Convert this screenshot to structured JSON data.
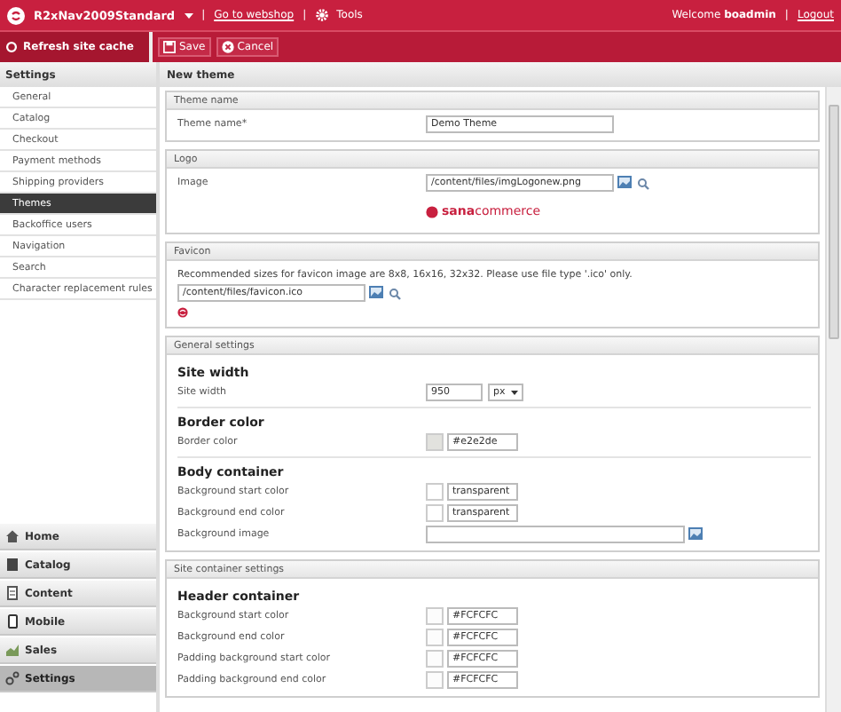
{
  "top_bar": {
    "site": "R2xNav2009Standard",
    "separator_1": "|",
    "webshop_link": "Go to webshop",
    "separator_2": "|",
    "tools": "Tools",
    "welcome": "Welcome **boadmin**",
    "separator_3": "|",
    "logout": "Logout"
  },
  "toolbar": {
    "refresh": "Refresh site cache",
    "save": "Save",
    "cancel": "Cancel"
  },
  "sidebar": {
    "title": "Settings",
    "items": [
      {
        "label": "General",
        "selected": false
      },
      {
        "label": "Catalog",
        "selected": false
      },
      {
        "label": "Checkout",
        "selected": false
      },
      {
        "label": "Payment methods",
        "selected": false
      },
      {
        "label": "Shipping providers",
        "selected": false
      },
      {
        "label": "Themes",
        "selected": true
      },
      {
        "label": "Backoffice users",
        "selected": false
      },
      {
        "label": "Navigation",
        "selected": false
      },
      {
        "label": "Search",
        "selected": false
      },
      {
        "label": "Character replacement rules",
        "selected": false
      }
    ],
    "nav": [
      {
        "label": "Home",
        "kind": "home",
        "selected": false
      },
      {
        "label": "Catalog",
        "kind": "catalog",
        "selected": false
      },
      {
        "label": "Content",
        "kind": "content",
        "selected": false
      },
      {
        "label": "Mobile",
        "kind": "mobile",
        "selected": false
      },
      {
        "label": "Sales",
        "kind": "sales",
        "selected": false
      },
      {
        "label": "Settings",
        "kind": "settings",
        "selected": true
      }
    ]
  },
  "page": {
    "title": "New theme",
    "sections": [
      {
        "title": "Theme name",
        "fields": [
          {
            "kind": "input",
            "label": "Theme name*",
            "value": "Demo Theme"
          }
        ]
      },
      {
        "title": "Logo",
        "fields": [
          {
            "kind": "file",
            "label": "Image",
            "value": "/content/files/imgLogonew.png"
          },
          {
            "kind": "logo",
            "text": "**sana**commerce"
          }
        ]
      },
      {
        "title": "Favicon",
        "fields": [
          {
            "kind": "note",
            "text": "Recommended sizes for favicon image are 8x8, 16x16, 32x32. Please use file type '.ico' only."
          },
          {
            "kind": "file",
            "value": "/content/files/favicon.ico"
          },
          {
            "kind": "favicon"
          }
        ]
      },
      {
        "title": "General settings",
        "fields": [
          {
            "kind": "heading",
            "text": "Site width"
          },
          {
            "kind": "size",
            "label": "Site width",
            "value": "950",
            "unit": "px"
          },
          {
            "kind": "heading",
            "text": "Border color"
          },
          {
            "kind": "color",
            "label": "Border color",
            "value": "#e2e2de"
          },
          {
            "kind": "heading",
            "text": "Body container"
          },
          {
            "kind": "color",
            "label": "Background start color",
            "value": "transparent"
          },
          {
            "kind": "color",
            "label": "Background end color",
            "value": "transparent"
          },
          {
            "kind": "image",
            "label": "Background image"
          }
        ]
      },
      {
        "title": "Site container settings",
        "fields": [
          {
            "kind": "heading",
            "text": "Header container"
          },
          {
            "kind": "color",
            "label": "Background start color",
            "value": "#FCFCFC"
          },
          {
            "kind": "color",
            "label": "Background end color",
            "value": "#FCFCFC"
          },
          {
            "kind": "color",
            "label": "Padding background start color",
            "value": "#FCFCFC"
          },
          {
            "kind": "color",
            "label": "Padding background end color",
            "value": "#FCFCFC"
          }
        ]
      }
    ]
  }
}
